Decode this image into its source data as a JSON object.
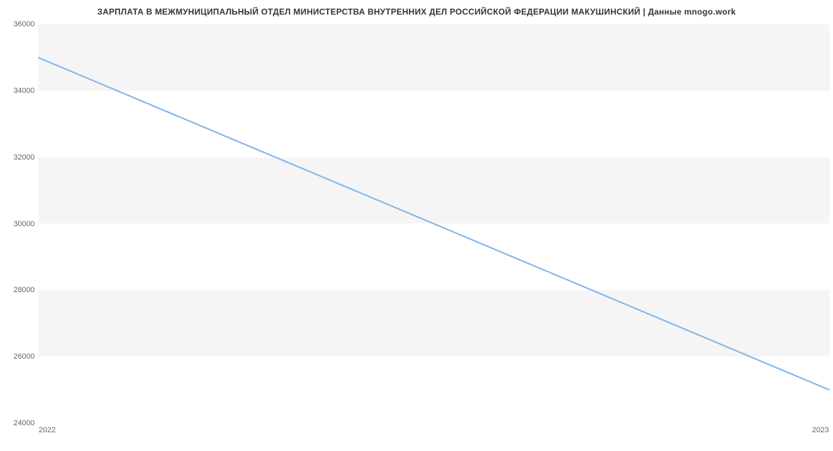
{
  "title": "ЗАРПЛАТА В МЕЖМУНИЦИПАЛЬНЫЙ ОТДЕЛ МИНИСТЕРСТВА ВНУТРЕННИХ ДЕЛ РОССИЙСКОЙ ФЕДЕРАЦИИ МАКУШИНСКИЙ | Данные mnogo.work",
  "yTicks": {
    "t0": "24000",
    "t1": "26000",
    "t2": "28000",
    "t3": "30000",
    "t4": "32000",
    "t5": "34000",
    "t6": "36000"
  },
  "xTicks": {
    "t0": "2022",
    "t1": "2023"
  },
  "chart_data": {
    "type": "line",
    "title": "ЗАРПЛАТА В МЕЖМУНИЦИПАЛЬНЫЙ ОТДЕЛ МИНИСТЕРСТВА ВНУТРЕННИХ ДЕЛ РОССИЙСКОЙ ФЕДЕРАЦИИ МАКУШИНСКИЙ | Данные mnogo.work",
    "xlabel": "",
    "ylabel": "",
    "x": [
      "2022",
      "2023"
    ],
    "values": [
      35000,
      25000
    ],
    "ylim": [
      24000,
      36000
    ],
    "y_ticks": [
      24000,
      26000,
      28000,
      30000,
      32000,
      34000,
      36000
    ]
  }
}
